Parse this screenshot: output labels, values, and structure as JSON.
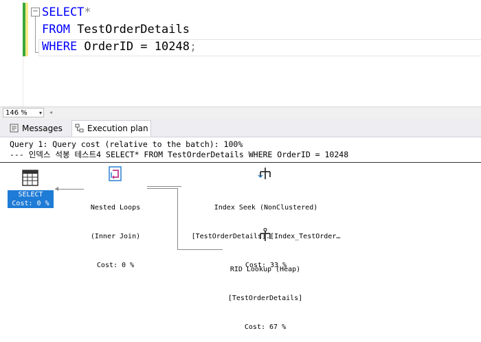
{
  "editor": {
    "collapse_glyph": "−",
    "line1_kw": "SELECT",
    "line1_rest": "*",
    "line2_kw": "FROM",
    "line2_rest": " TestOrderDetails",
    "line3_kw": "WHERE",
    "line3_rest": " OrderID = 10248",
    "line3_end": ";"
  },
  "zoom": {
    "value": "146 %",
    "arrow": "▾",
    "scroll_glyph": "◂"
  },
  "tabs": [
    {
      "label": "Messages",
      "icon": "messages-icon",
      "active": false
    },
    {
      "label": "Execution plan",
      "icon": "execution-plan-icon",
      "active": true
    }
  ],
  "plan": {
    "header_line1": "Query 1: Query cost (relative to the batch): 100%",
    "header_line2": "--- 인덱스 석봉 테스트4 SELECT* FROM TestOrderDetails WHERE OrderID = 10248",
    "nodes": {
      "select": {
        "line1": "SELECT",
        "line2": "Cost: 0 %"
      },
      "nested_loops": {
        "line1": "Nested Loops",
        "line2": "(Inner Join)",
        "line3": "Cost: 0 %"
      },
      "index_seek": {
        "line1": "Index Seek (NonClustered)",
        "line2": "[TestOrderDetails].[Index_TestOrder…",
        "line3": "Cost: 33 %"
      },
      "rid_lookup": {
        "line1": "RID Lookup (Heap)",
        "line2": "[TestOrderDetails]",
        "line3": "Cost: 67 %"
      }
    }
  },
  "colors": {
    "keyword": "#0000ff",
    "selected_node": "#1e7bd6",
    "gutter_green": "#3aa83a"
  }
}
